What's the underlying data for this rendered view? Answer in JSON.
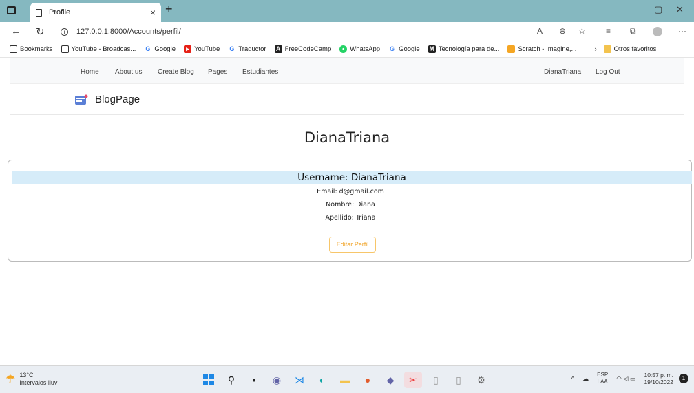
{
  "browser": {
    "tab_title": "Profile",
    "url": "127.0.0.1:8000/Accounts/perfil/",
    "bookmarks": [
      {
        "label": "Bookmarks",
        "icon": "page-icon"
      },
      {
        "label": "YouTube - Broadcas...",
        "icon": "page-icon"
      },
      {
        "label": "Google",
        "icon": "google-icon"
      },
      {
        "label": "YouTube",
        "icon": "youtube-icon"
      },
      {
        "label": "Traductor",
        "icon": "google-icon"
      },
      {
        "label": "FreeCodeCamp",
        "icon": "freecodecamp-icon"
      },
      {
        "label": "WhatsApp",
        "icon": "whatsapp-icon"
      },
      {
        "label": "Google",
        "icon": "google-icon"
      },
      {
        "label": "Tecnología para de...",
        "icon": "m-icon"
      },
      {
        "label": "Scratch - Imagine,...",
        "icon": "scratch-icon"
      }
    ],
    "other_favorites": "Otros favoritos"
  },
  "nav": {
    "left": [
      "Home",
      "About us",
      "Create Blog",
      "Pages",
      "Estudiantes"
    ],
    "user": "DianaTriana",
    "logout": "Log Out"
  },
  "brand": "BlogPage",
  "profile": {
    "heading": "DianaTriana",
    "username": "Username: DianaTriana",
    "email": "Email: d@gmail.com",
    "nombre": "Nombre: Diana",
    "apellido": "Apellido: Triana",
    "edit_button": "Editar Perfil"
  },
  "taskbar": {
    "temp": "13°C",
    "weather": "Intervalos lluv",
    "lang": "ESP",
    "lang2": "LAA",
    "time": "10:57 p. m.",
    "date": "19/10/2022",
    "notifications": "1"
  },
  "colors": {
    "accent": "#85b8c0",
    "highlight": "#d6ecf9",
    "button": "#f0a52b"
  }
}
